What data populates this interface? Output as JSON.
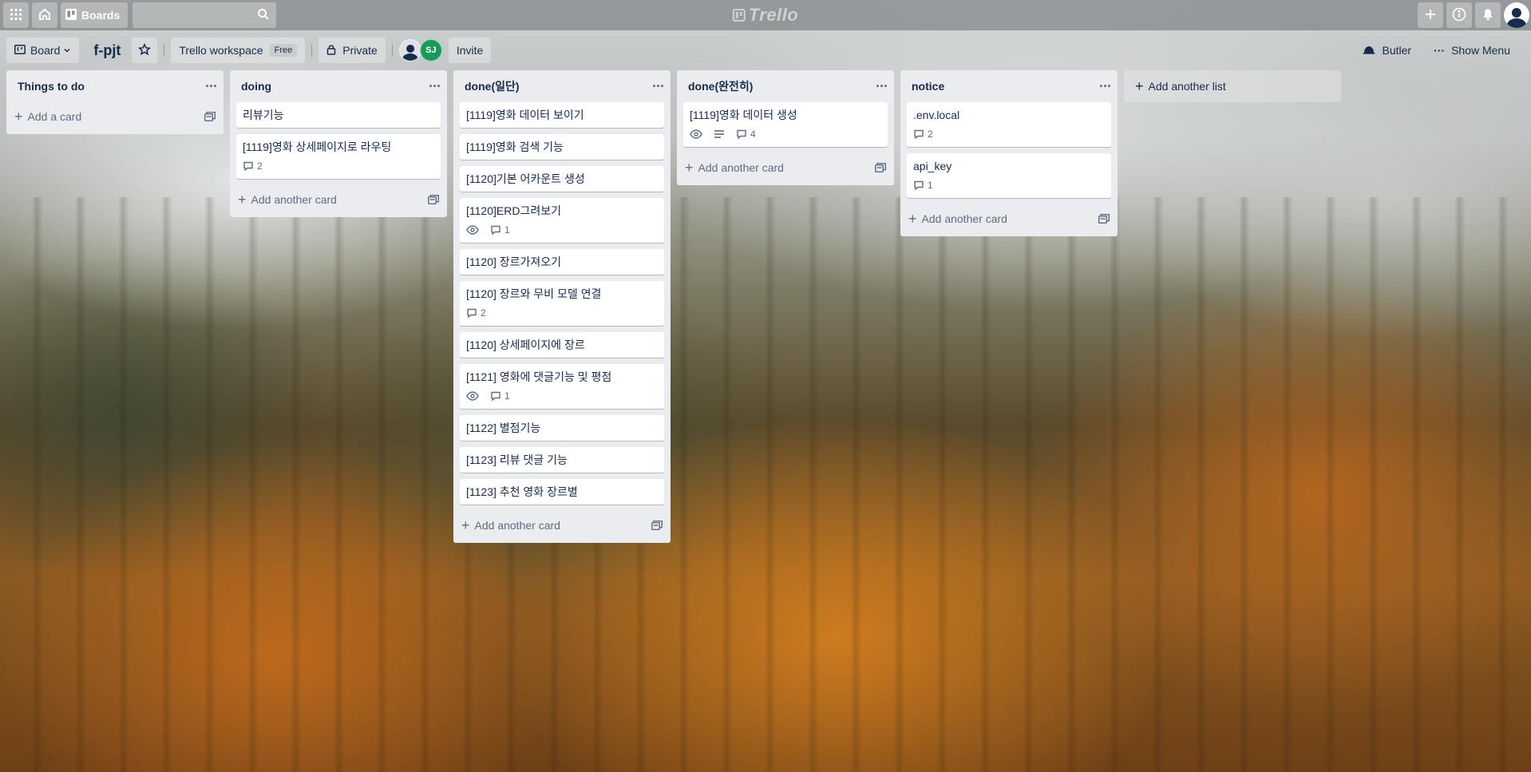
{
  "header": {
    "boards_label": "Boards",
    "logo_text": "Trello"
  },
  "boardbar": {
    "view_label": "Board",
    "title": "f-pjt",
    "workspace_label": "Trello workspace",
    "workspace_badge": "Free",
    "visibility_label": "Private",
    "member_initials": "SJ",
    "invite_label": "Invite",
    "butler_label": "Butler",
    "menu_label": "Show Menu"
  },
  "lists": [
    {
      "title": "Things to do",
      "cards": [],
      "add_label": "Add a card"
    },
    {
      "title": "doing",
      "cards": [
        {
          "title": "리뷰기능"
        },
        {
          "title": "[1119]영화 상세페이지로 라우팅",
          "comments": "2"
        }
      ],
      "add_label": "Add another card"
    },
    {
      "title": "done(일단)",
      "cards": [
        {
          "title": "[1119]영화 데이터 보이기"
        },
        {
          "title": "[1119]영화 검색 기능"
        },
        {
          "title": "[1120]기본 어카운트 생성"
        },
        {
          "title": "[1120]ERD그려보기",
          "watch": true,
          "comments": "1"
        },
        {
          "title": "[1120] 장르가져오기"
        },
        {
          "title": "[1120] 장르와 무비 모델 연결",
          "comments": "2"
        },
        {
          "title": "[1120] 상세페이지에 장르"
        },
        {
          "title": "[1121] 영화에 댓글기능 및 평점",
          "watch": true,
          "comments": "1"
        },
        {
          "title": "[1122] 별점기능"
        },
        {
          "title": "[1123] 리뷰 댓글 기능"
        },
        {
          "title": "[1123] 추천 영화 장르별"
        }
      ],
      "add_label": "Add another card"
    },
    {
      "title": "done(완전히)",
      "cards": [
        {
          "title": "[1119]영화 데이터 생성",
          "watch": true,
          "description": true,
          "comments": "4"
        }
      ],
      "add_label": "Add another card"
    },
    {
      "title": "notice",
      "cards": [
        {
          "title": ".env.local",
          "comments": "2"
        },
        {
          "title": "api_key",
          "comments": "1"
        }
      ],
      "add_label": "Add another card"
    }
  ],
  "add_list_label": "Add another list",
  "icons": {
    "apps": "grid-icon",
    "home": "home-icon",
    "boards": "board-icon",
    "search": "search-icon",
    "create": "plus-icon",
    "info": "info-icon",
    "notifications": "bell-icon",
    "star": "star-icon",
    "lock": "lock-icon",
    "butler": "butler-icon",
    "more": "dots-icon",
    "template": "card-template-icon",
    "comment": "comment-icon",
    "watch": "eye-icon",
    "description": "description-icon"
  }
}
